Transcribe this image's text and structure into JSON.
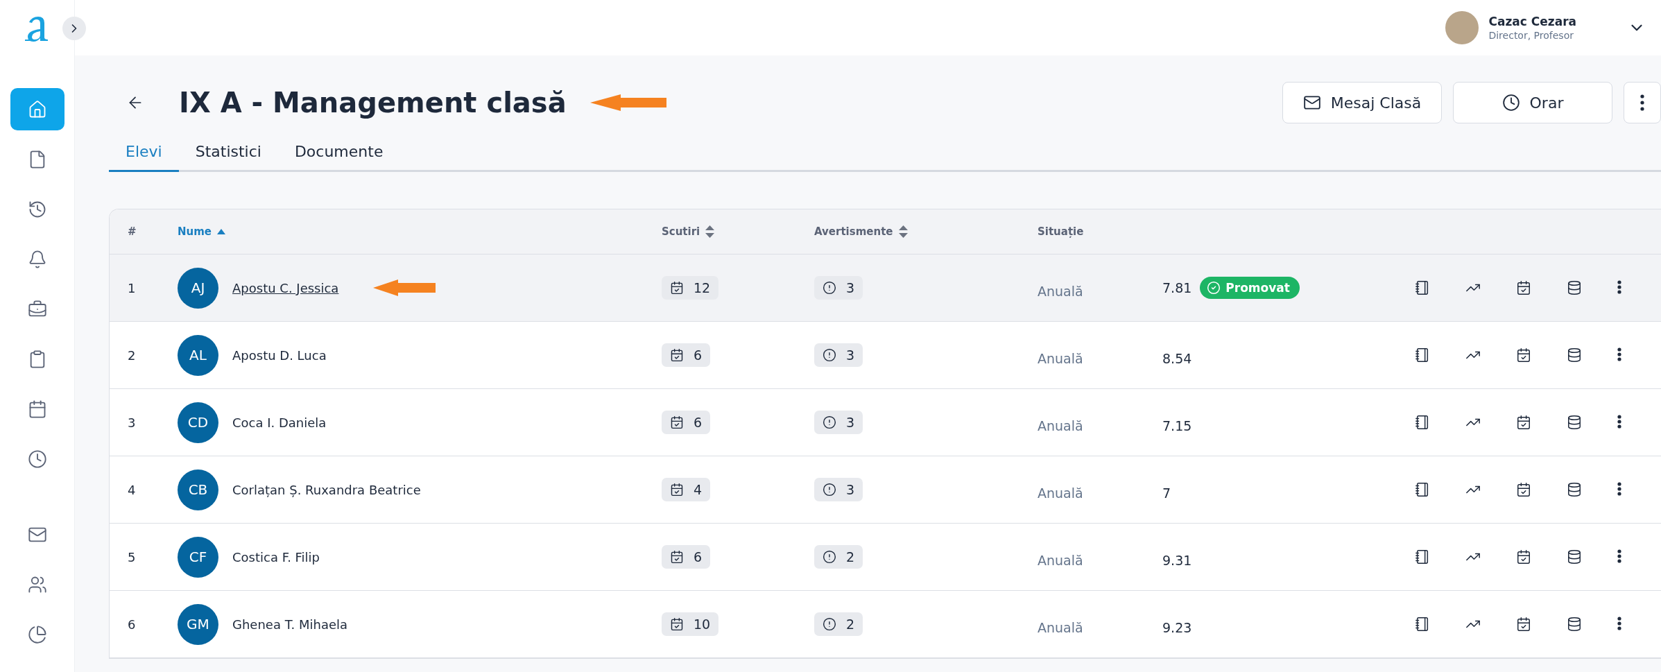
{
  "sidebar": {
    "main_items": [
      {
        "selected": true
      },
      {
        "selected": false
      },
      {
        "selected": false
      },
      {
        "selected": false
      },
      {
        "selected": false
      },
      {
        "selected": false
      },
      {
        "selected": false
      },
      {
        "selected": false
      }
    ],
    "bottom_items": [
      {
        "selected": false
      },
      {
        "selected": false
      },
      {
        "selected": false
      }
    ]
  },
  "user": {
    "name": "Cazac Cezara",
    "role": "Director, Profesor"
  },
  "header": {
    "title": "IX A - Management clasă",
    "annotated": true,
    "buttons": [
      {
        "kind": "mail",
        "label": "Mesaj Clasă"
      },
      {
        "kind": "clock",
        "label": "Orar"
      },
      {
        "kind": "more"
      }
    ]
  },
  "tabs": [
    {
      "label": "Elevi",
      "selected": true
    },
    {
      "label": "Statistici",
      "selected": false
    },
    {
      "label": "Documente",
      "selected": false
    }
  ],
  "table": {
    "columns": [
      {
        "label": "#"
      },
      {
        "label": "Nume",
        "sortable": true,
        "sorted": true
      },
      {
        "label": "Scutiri",
        "sortable": true,
        "sorted": false
      },
      {
        "label": "Avertismente",
        "sortable": true,
        "sorted": false
      },
      {
        "label": "Situație"
      }
    ],
    "rows": [
      {
        "num": "1",
        "initials": "AJ",
        "name": "Apostu C. Jessica",
        "scutiri": "12",
        "avertismente": "3",
        "situatie": "Anuală",
        "grade": "7.81",
        "badge": "Promovat",
        "selected": true,
        "annotated": true
      },
      {
        "num": "2",
        "initials": "AL",
        "name": "Apostu D. Luca",
        "scutiri": "6",
        "avertismente": "3",
        "situatie": "Anuală",
        "grade": "8.54",
        "selected": false,
        "annotated": false
      },
      {
        "num": "3",
        "initials": "CD",
        "name": "Coca I. Daniela",
        "scutiri": "6",
        "avertismente": "3",
        "situatie": "Anuală",
        "grade": "7.15",
        "selected": false,
        "annotated": false
      },
      {
        "num": "4",
        "initials": "CB",
        "name": "Corlațan Ș. Ruxandra Beatrice",
        "scutiri": "4",
        "avertismente": "3",
        "situatie": "Anuală",
        "grade": "7",
        "selected": false,
        "annotated": false
      },
      {
        "num": "5",
        "initials": "CF",
        "name": "Costica F. Filip",
        "scutiri": "6",
        "avertismente": "2",
        "situatie": "Anuală",
        "grade": "9.31",
        "selected": false,
        "annotated": false
      },
      {
        "num": "6",
        "initials": "GM",
        "name": "Ghenea T. Mihaela",
        "scutiri": "10",
        "avertismente": "2",
        "situatie": "Anuală",
        "grade": "9.23",
        "selected": false,
        "annotated": false
      }
    ]
  }
}
